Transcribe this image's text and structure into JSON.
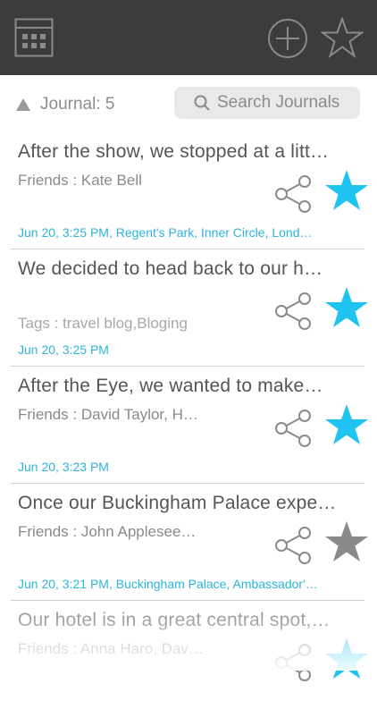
{
  "colors": {
    "topbar": "#3c3c3c",
    "accent": "#2bb5de",
    "star_active": "#1fc3f0",
    "star_inactive": "#8a8a8a",
    "icon_outline": "#8a8a8a"
  },
  "header": {
    "left_icon": "calendar-grid-icon",
    "add_icon": "plus-circle-icon",
    "right_icon": "star-outline-icon"
  },
  "toolbar": {
    "sort_icon": "triangle-up-icon",
    "journal_count": "Journal: 5",
    "search_placeholder": "Search Journals"
  },
  "entries": [
    {
      "title": "After the show, we stopped at a litt…",
      "friends": "Friends : Kate  Bell",
      "tags": "",
      "meta": "Jun 20, 3:25 PM, Regent's Park, Inner Circle, Lond…",
      "starred": true
    },
    {
      "title": "We decided to head back to our h…",
      "friends": "",
      "tags": "Tags : travel blog,Bloging",
      "meta": "Jun 20, 3:25 PM",
      "starred": true
    },
    {
      "title": "After the Eye, we wanted to make…",
      "friends": "Friends : David  Taylor, H…",
      "tags": "",
      "meta": "Jun 20, 3:23 PM",
      "starred": true
    },
    {
      "title": "Once our Buckingham Palace expe…",
      "friends": "Friends : John  Applesee…",
      "tags": "",
      "meta": "Jun 20, 3:21 PM, Buckingham Palace, Ambassador'…",
      "starred": false
    },
    {
      "title": "Our hotel is in a great central spot,…",
      "friends": "Friends : Anna  Haro, Dav…",
      "tags": "",
      "meta": "",
      "starred": true
    }
  ]
}
